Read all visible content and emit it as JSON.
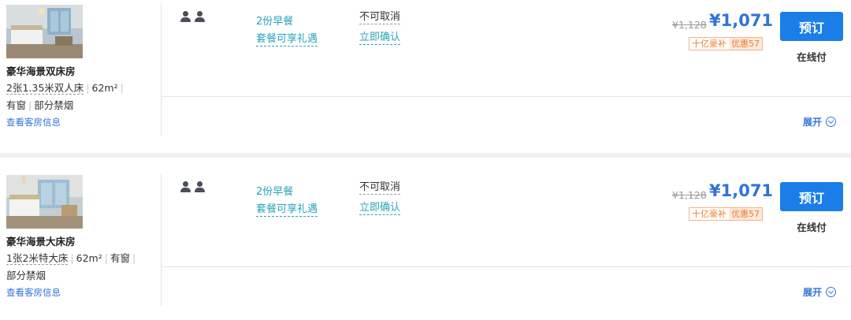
{
  "rooms": [
    {
      "name": "豪华海景双床房",
      "specs": [
        {
          "text": "2张1.35米双人床",
          "underline": true
        },
        {
          "text": "62m²",
          "underline": false
        },
        {
          "text": "有窗",
          "underline": false
        },
        {
          "text": "部分禁烟",
          "underline": false
        }
      ],
      "view_link": "查看客房信息",
      "meal": "2份早餐",
      "package": "套餐可享礼遇",
      "cancel_policy": "不可取消",
      "confirm": "立即确认",
      "original_price": "¥1,128",
      "price": "¥1,071",
      "tag_label": "十亿豪补",
      "tag_discount": "优惠57",
      "book_label": "预订",
      "pay_label": "在线付",
      "expand_label": "展开"
    },
    {
      "name": "豪华海景大床房",
      "specs": [
        {
          "text": "1张2米特大床",
          "underline": true
        },
        {
          "text": "62m²",
          "underline": false
        },
        {
          "text": "有窗",
          "underline": false
        },
        {
          "text": "部分禁烟",
          "underline": false
        }
      ],
      "view_link": "查看客房信息",
      "meal": "2份早餐",
      "package": "套餐可享礼遇",
      "cancel_policy": "不可取消",
      "confirm": "立即确认",
      "original_price": "¥1,128",
      "price": "¥1,071",
      "tag_label": "十亿豪补",
      "tag_discount": "优惠57",
      "book_label": "预订",
      "pay_label": "在线付",
      "expand_label": "展开"
    }
  ],
  "icons": {
    "guest": "person-icon",
    "expand": "chevron-down-circle-icon"
  },
  "colors": {
    "accent": "#2f73d9",
    "button": "#1a7ee8",
    "link_teal": "#2aa3bd",
    "promo_orange": "#f07c2e"
  }
}
